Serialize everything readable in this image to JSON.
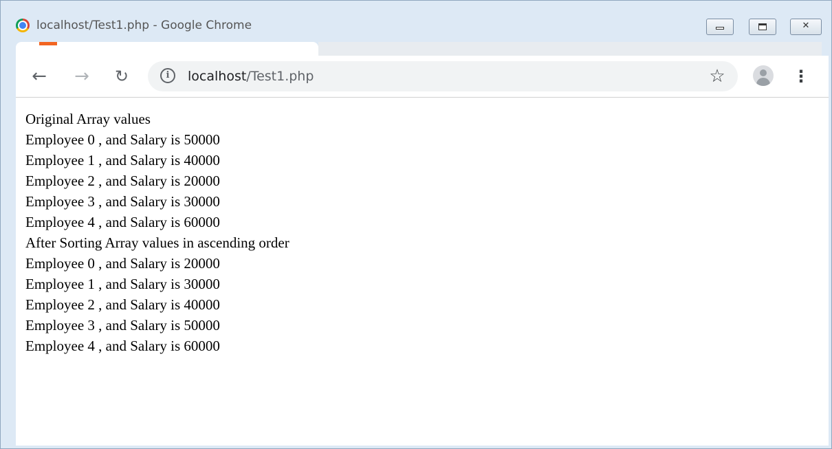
{
  "window": {
    "title": "localhost/Test1.php - Google Chrome"
  },
  "toolbar": {
    "back_icon": "arrow-left",
    "forward_icon": "arrow-right",
    "reload_icon": "reload",
    "info_icon": "info",
    "star_icon": "star",
    "menu_icon": "vertical-ellipsis",
    "url_host": "localhost",
    "url_path": "/Test1.php"
  },
  "page": {
    "lines": [
      "Original Array values",
      "Employee 0 , and Salary is 50000",
      "Employee 1 , and Salary is 40000",
      "Employee 2 , and Salary is 20000",
      "Employee 3 , and Salary is 30000",
      "Employee 4 , and Salary is 60000",
      "After Sorting Array values in ascending order",
      "Employee 0 , and Salary is 20000",
      "Employee 1 , and Salary is 30000",
      "Employee 2 , and Salary is 40000",
      "Employee 3 , and Salary is 50000",
      "Employee 4 , and Salary is 60000"
    ]
  }
}
